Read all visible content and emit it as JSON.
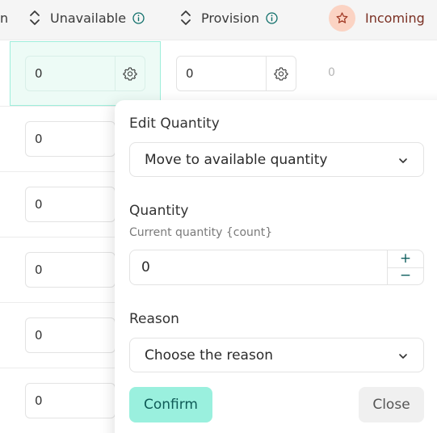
{
  "header": {
    "partial_label": "n",
    "unavailable_label": "Unavailable",
    "provision_label": "Provision",
    "incoming_label": "Incoming"
  },
  "rows": [
    {
      "unavailable": "0",
      "provision": "0",
      "incoming": "0"
    },
    {
      "unavailable": "0"
    },
    {
      "unavailable": "0"
    },
    {
      "unavailable": "0"
    },
    {
      "unavailable": "0"
    },
    {
      "unavailable": "0"
    }
  ],
  "popover": {
    "title": "Edit Quantity",
    "action_selected": "Move to available quantity",
    "quantity_label": "Quantity",
    "quantity_hint": "Current quantity {count}",
    "quantity_value": "0",
    "plus": "+",
    "minus": "−",
    "reason_label": "Reason",
    "reason_placeholder": "Choose the reason",
    "confirm_label": "Confirm",
    "close_label": "Close"
  },
  "colors": {
    "accent": "#9af0de",
    "accent_text": "#0f5b57",
    "selected_cell_bg": "#edfbf6",
    "incoming_badge": "#fbd3c3"
  }
}
